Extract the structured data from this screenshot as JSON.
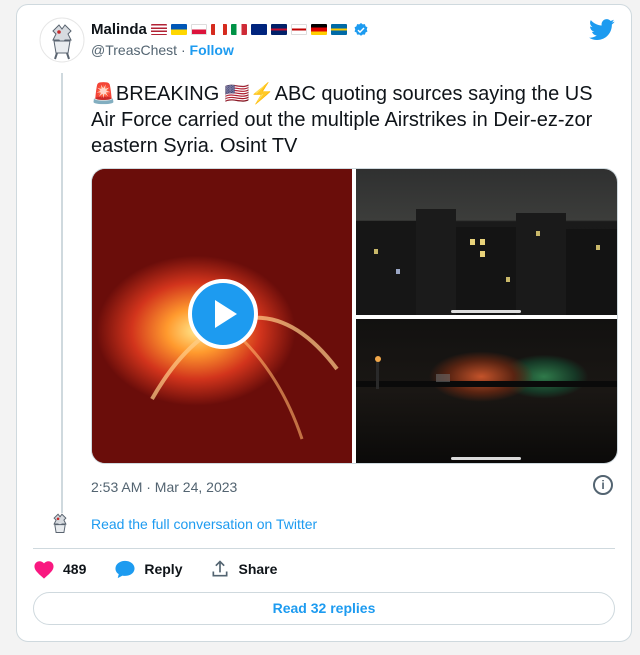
{
  "author": {
    "name": "Malinda",
    "handle": "@TreasChest",
    "separator": " · ",
    "follow_label": "Follow",
    "flags": [
      "us",
      "ua",
      "pl",
      "ca",
      "it",
      "au",
      "gb",
      "to",
      "de",
      "se"
    ]
  },
  "tweet": {
    "alert_emoji": "🚨",
    "flag_emoji": "🇺🇸",
    "bolt_emoji": "⚡",
    "text_part1": "BREAKING ",
    "text_part2": "ABC quoting sources saying the US Air Force carried out the multiple Airstrikes in Deir-ez-zor eastern Syria. Osint TV",
    "timestamp": "2:53 AM · Mar 24, 2023",
    "info_glyph": "i"
  },
  "thread": {
    "read_full": "Read the full conversation on Twitter"
  },
  "actions": {
    "like_count": "489",
    "reply_label": "Reply",
    "share_label": "Share",
    "read_replies": "Read 32 replies"
  },
  "colors": {
    "accent": "#1d9bf0",
    "like": "#f91880",
    "text": "#0f1419",
    "muted": "#536471"
  }
}
